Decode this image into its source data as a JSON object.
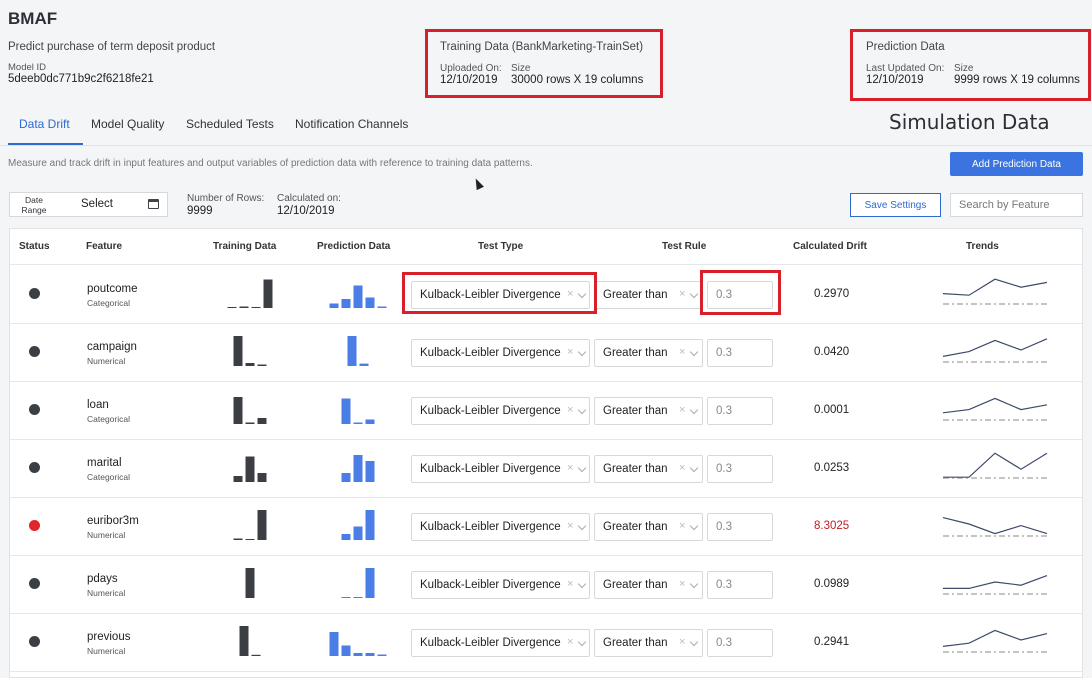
{
  "app": {
    "title": "BMAF",
    "subtitle": "Predict purchase of term deposit product",
    "model_id_label": "Model ID",
    "model_id": "5deeb0dc771b9c2f6218fe21"
  },
  "training": {
    "title": "Training Data (BankMarketing-TrainSet)",
    "uploaded_label": "Uploaded On:",
    "uploaded_value": "12/10/2019",
    "size_label": "Size",
    "size_value": "30000 rows X 19 columns"
  },
  "prediction": {
    "title": "Prediction Data",
    "updated_label": "Last Updated On:",
    "updated_value": "12/10/2019",
    "size_label": "Size",
    "size_value": "9999 rows X 19 columns"
  },
  "simulation_label": "Simulation Data",
  "tabs": [
    {
      "label": "Data Drift",
      "active": true
    },
    {
      "label": "Model Quality"
    },
    {
      "label": "Scheduled Tests"
    },
    {
      "label": "Notification Channels"
    }
  ],
  "description": "Measure and track drift in input features and output variables of prediction data with reference to training data patterns.",
  "add_button": "Add Prediction Data",
  "filters": {
    "date_range_label": "Date Range",
    "date_range_value": "Select",
    "rows_label": "Number of Rows:",
    "rows_value": "9999",
    "calc_label": "Calculated on:",
    "calc_value": "12/10/2019",
    "save_button": "Save Settings",
    "search_placeholder": "Search by Feature"
  },
  "table": {
    "headers": {
      "status": "Status",
      "feature": "Feature",
      "training": "Training Data",
      "prediction": "Prediction Data",
      "test_type": "Test Type",
      "test_rule": "Test Rule",
      "drift": "Calculated Drift",
      "trends": "Trends"
    },
    "rows": [
      {
        "name": "poutcome",
        "type": "Categorical",
        "status": "ok",
        "test": "Kulback-Leibler Divergence",
        "rule": "Greater than",
        "threshold": "0.3",
        "drift": "0.2970",
        "train_bars": [
          0,
          0.05,
          0,
          0.95
        ],
        "pred_bars": [
          0.15,
          0.3,
          0.75,
          0.35,
          0.05
        ],
        "trend": [
          0.55,
          0.6,
          0.1,
          0.35,
          0.2
        ]
      },
      {
        "name": "campaign",
        "type": "Numerical",
        "status": "ok",
        "test": "Kulback-Leibler Divergence",
        "rule": "Greater than",
        "threshold": "0.3",
        "drift": "0.0420",
        "train_bars": [
          1,
          0.1,
          0.05
        ],
        "pred_bars": [
          1,
          0.08
        ],
        "trend": [
          0.7,
          0.55,
          0.2,
          0.5,
          0.15
        ]
      },
      {
        "name": "loan",
        "type": "Categorical",
        "status": "ok",
        "test": "Kulback-Leibler Divergence",
        "rule": "Greater than",
        "threshold": "0.3",
        "drift": "0.0001",
        "train_bars": [
          0.9,
          0.05,
          0.2
        ],
        "pred_bars": [
          0.85,
          0.05,
          0.15
        ],
        "trend": [
          0.65,
          0.55,
          0.2,
          0.55,
          0.4
        ]
      },
      {
        "name": "marital",
        "type": "Categorical",
        "status": "ok",
        "test": "Kulback-Leibler Divergence",
        "rule": "Greater than",
        "threshold": "0.3",
        "drift": "0.0253",
        "train_bars": [
          0.2,
          0.85,
          0.3
        ],
        "pred_bars": [
          0.3,
          0.9,
          0.7
        ],
        "trend": [
          0.85,
          0.85,
          0.1,
          0.6,
          0.1
        ]
      },
      {
        "name": "euribor3m",
        "type": "Numerical",
        "status": "alert",
        "test": "Kulback-Leibler Divergence",
        "rule": "Greater than",
        "threshold": "0.3",
        "drift": "8.3025",
        "train_bars": [
          0.05,
          0.03,
          1
        ],
        "pred_bars": [
          0.2,
          0.45,
          1
        ],
        "trend": [
          0.3,
          0.5,
          0.8,
          0.55,
          0.8
        ]
      },
      {
        "name": "pdays",
        "type": "Numerical",
        "status": "ok",
        "test": "Kulback-Leibler Divergence",
        "rule": "Greater than",
        "threshold": "0.3",
        "drift": "0.0989",
        "train_bars": [
          1
        ],
        "pred_bars": [
          0.02,
          0.02,
          1
        ],
        "trend": [
          0.7,
          0.7,
          0.5,
          0.6,
          0.3
        ]
      },
      {
        "name": "previous",
        "type": "Numerical",
        "status": "ok",
        "test": "Kulback-Leibler Divergence",
        "rule": "Greater than",
        "threshold": "0.3",
        "drift": "0.2941",
        "train_bars": [
          1,
          0.04
        ],
        "pred_bars": [
          0.8,
          0.35,
          0.1,
          0.1,
          0.05
        ],
        "trend": [
          0.7,
          0.6,
          0.2,
          0.5,
          0.3
        ]
      }
    ]
  },
  "colors": {
    "accent": "#2d6ad1",
    "status_ok": "#3b3f44",
    "status_alert": "#e0262b",
    "training_bar": "#3b3f44",
    "prediction_bar": "#4a7de6",
    "highlight": "#d9202a"
  }
}
